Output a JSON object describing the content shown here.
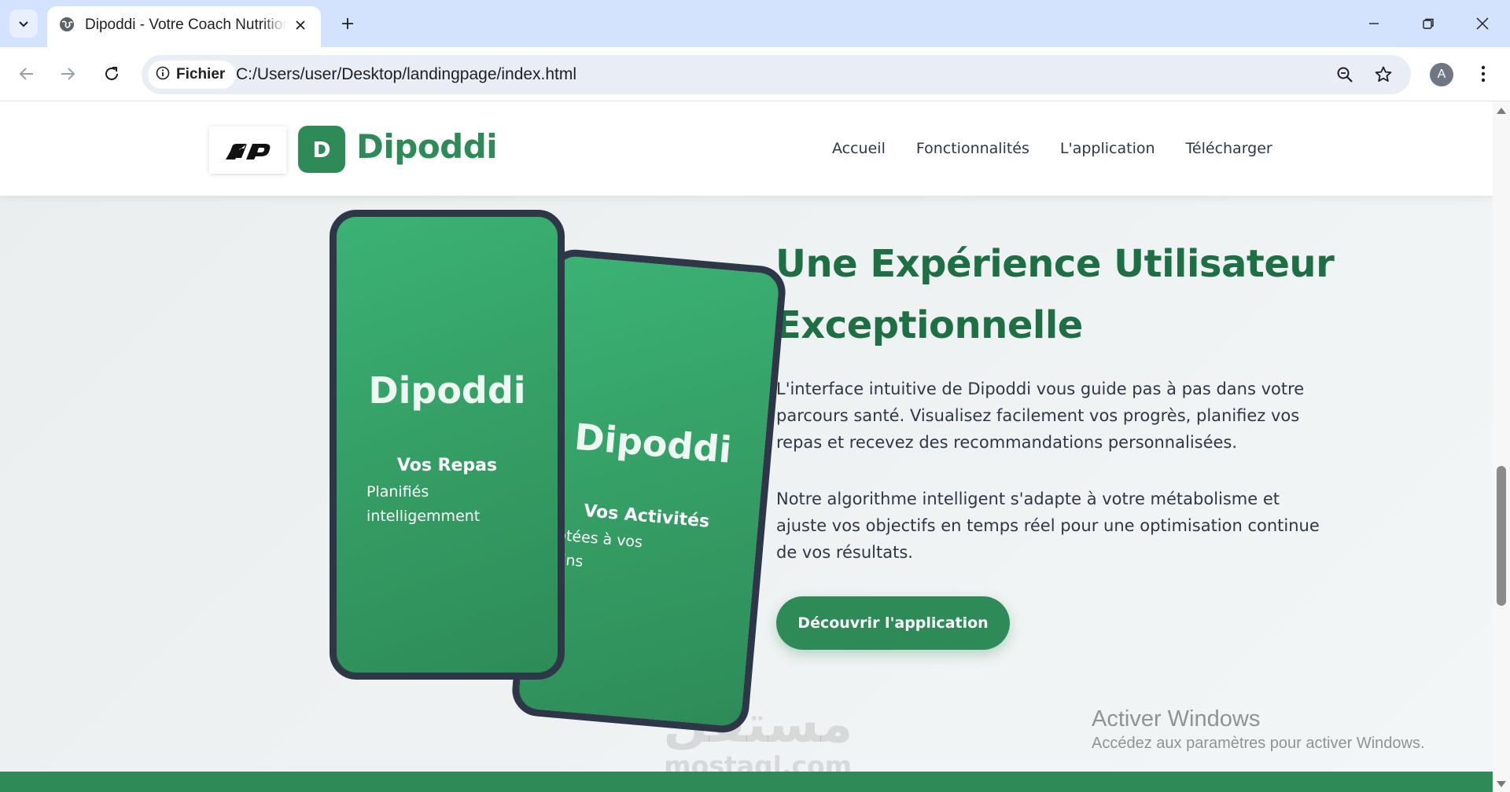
{
  "browser": {
    "tab_title": "Dipoddi - Votre Coach Nutrition",
    "site_chip_label": "Fichier",
    "url": "C:/Users/user/Desktop/landingpage/index.html",
    "profile_initial": "A",
    "icons": [
      "tab-search-icon",
      "globe-icon",
      "close-icon",
      "plus-icon",
      "minimize-icon",
      "restore-icon",
      "window-close-icon",
      "back-arrow-icon",
      "forward-arrow-icon",
      "reload-icon",
      "info-icon",
      "zoom-icon",
      "star-icon",
      "kebab-menu-icon"
    ]
  },
  "header": {
    "badge_letter": "D",
    "brand_name": "Dipoddi",
    "nav": [
      {
        "label": "Accueil"
      },
      {
        "label": "Fonctionnalités"
      },
      {
        "label": "L'application"
      },
      {
        "label": "Télécharger"
      }
    ]
  },
  "phones": {
    "front": {
      "brand": "Dipoddi",
      "feature_title": "Vos Repas",
      "feature_desc_line1": "Planifiés",
      "feature_desc_line2": "intelligemment"
    },
    "back": {
      "brand": "Dipoddi",
      "feature_title": "Vos Activités",
      "feature_desc_line1": "Adaptées à vos",
      "feature_desc_line2": "besoins"
    }
  },
  "content": {
    "title_line1": "Une Expérience Utilisateur",
    "title_line2": "Exceptionnelle",
    "paragraph_1": "L'interface intuitive de Dipoddi vous guide pas à pas dans votre parcours santé. Visualisez facilement vos progrès, planifiez vos repas et recevez des recommandations personnalisées.",
    "paragraph_2": "Notre algorithme intelligent s'adapte à votre métabolisme et ajuste vos objectifs en temps réel pour une optimisation continue de vos résultats.",
    "cta_label": "Découvrir l'application"
  },
  "overlays": {
    "watermark_arabic": "مستقل",
    "watermark_latin": "mostaql.com",
    "activate_title": "Activer Windows",
    "activate_subtitle": "Accédez aux paramètres pour activer Windows."
  },
  "colors": {
    "brand_green": "#2e8b57",
    "title_green": "#1f6f45",
    "phone_frame": "#2d3748",
    "chrome_tabbar": "#d3e3fd"
  }
}
